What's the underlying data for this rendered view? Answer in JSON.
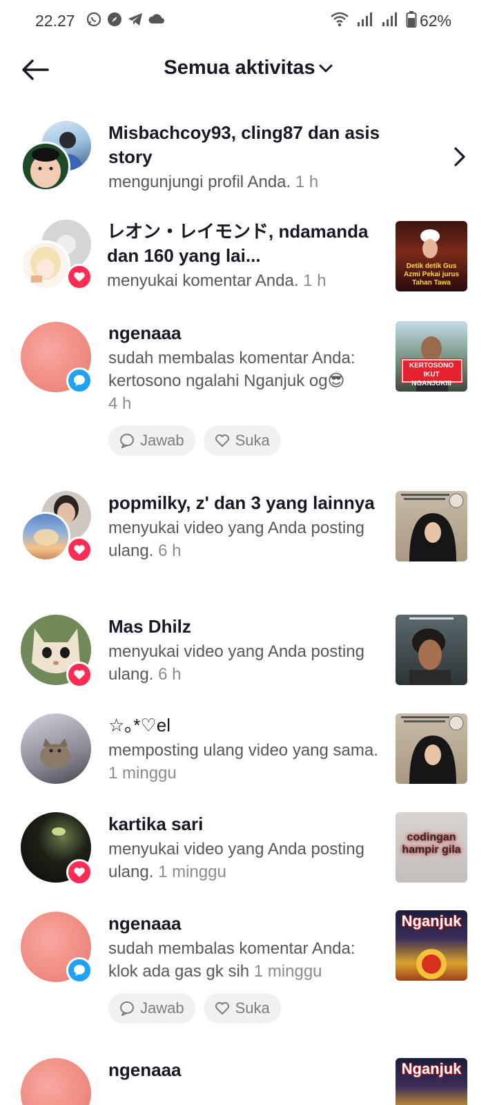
{
  "status_bar": {
    "time": "22.27",
    "battery": "62%",
    "left_icons": [
      "whatsapp-icon",
      "browser-icon",
      "telegram-icon",
      "cloud-icon"
    ],
    "right_icons": [
      "wifi-icon",
      "signal-icon",
      "signal-icon",
      "battery-icon"
    ]
  },
  "header": {
    "title": "Semua aktivitas"
  },
  "activities": [
    {
      "name": "Misbachcoy93, cling87 dan asis story",
      "desc": "mengunjungi profil Anda.",
      "time": "1 h",
      "badge": "none"
    },
    {
      "name": "レオン・レイモンド, ndamanda dan 160 yang lai...",
      "desc": "menyukai komentar Anda.",
      "time": "1 h",
      "badge": "like",
      "thumb_text": "Detik detik Gus Azmi Pekai jurus Tahan Tawa"
    },
    {
      "name": "ngenaaa",
      "desc": "sudah membalas komentar Anda: kertosono ngalahi Nganjuk og😎",
      "time": "4 h",
      "badge": "reply",
      "thumb_text": "KERTOSONO IKUT NGANJUKIII",
      "reply_label": "Jawab",
      "like_label": "Suka"
    },
    {
      "name": "popmilky, z' dan 3 yang lainnya",
      "desc": "menyukai video yang Anda posting ulang.",
      "time": "6 h",
      "badge": "like"
    },
    {
      "name": "Mas Dhilz",
      "desc": "menyukai video yang Anda posting ulang.",
      "time": "6 h",
      "badge": "like"
    },
    {
      "name": "☆｡*♡el",
      "desc": "memposting ulang video yang sama.",
      "time": "1 minggu",
      "badge": "none"
    },
    {
      "name": "kartika sari",
      "desc": "menyukai video yang Anda posting ulang.",
      "time": "1 minggu",
      "badge": "like",
      "thumb_text": "codingan hampir gila"
    },
    {
      "name": "ngenaaa",
      "desc": "sudah membalas komentar Anda: klok ada gas gk sih",
      "time": "1 minggu",
      "badge": "reply",
      "thumb_text": "Nganjuk",
      "reply_label": "Jawab",
      "like_label": "Suka"
    },
    {
      "name": "ngenaaa",
      "thumb_text": "Nganjuk"
    }
  ]
}
